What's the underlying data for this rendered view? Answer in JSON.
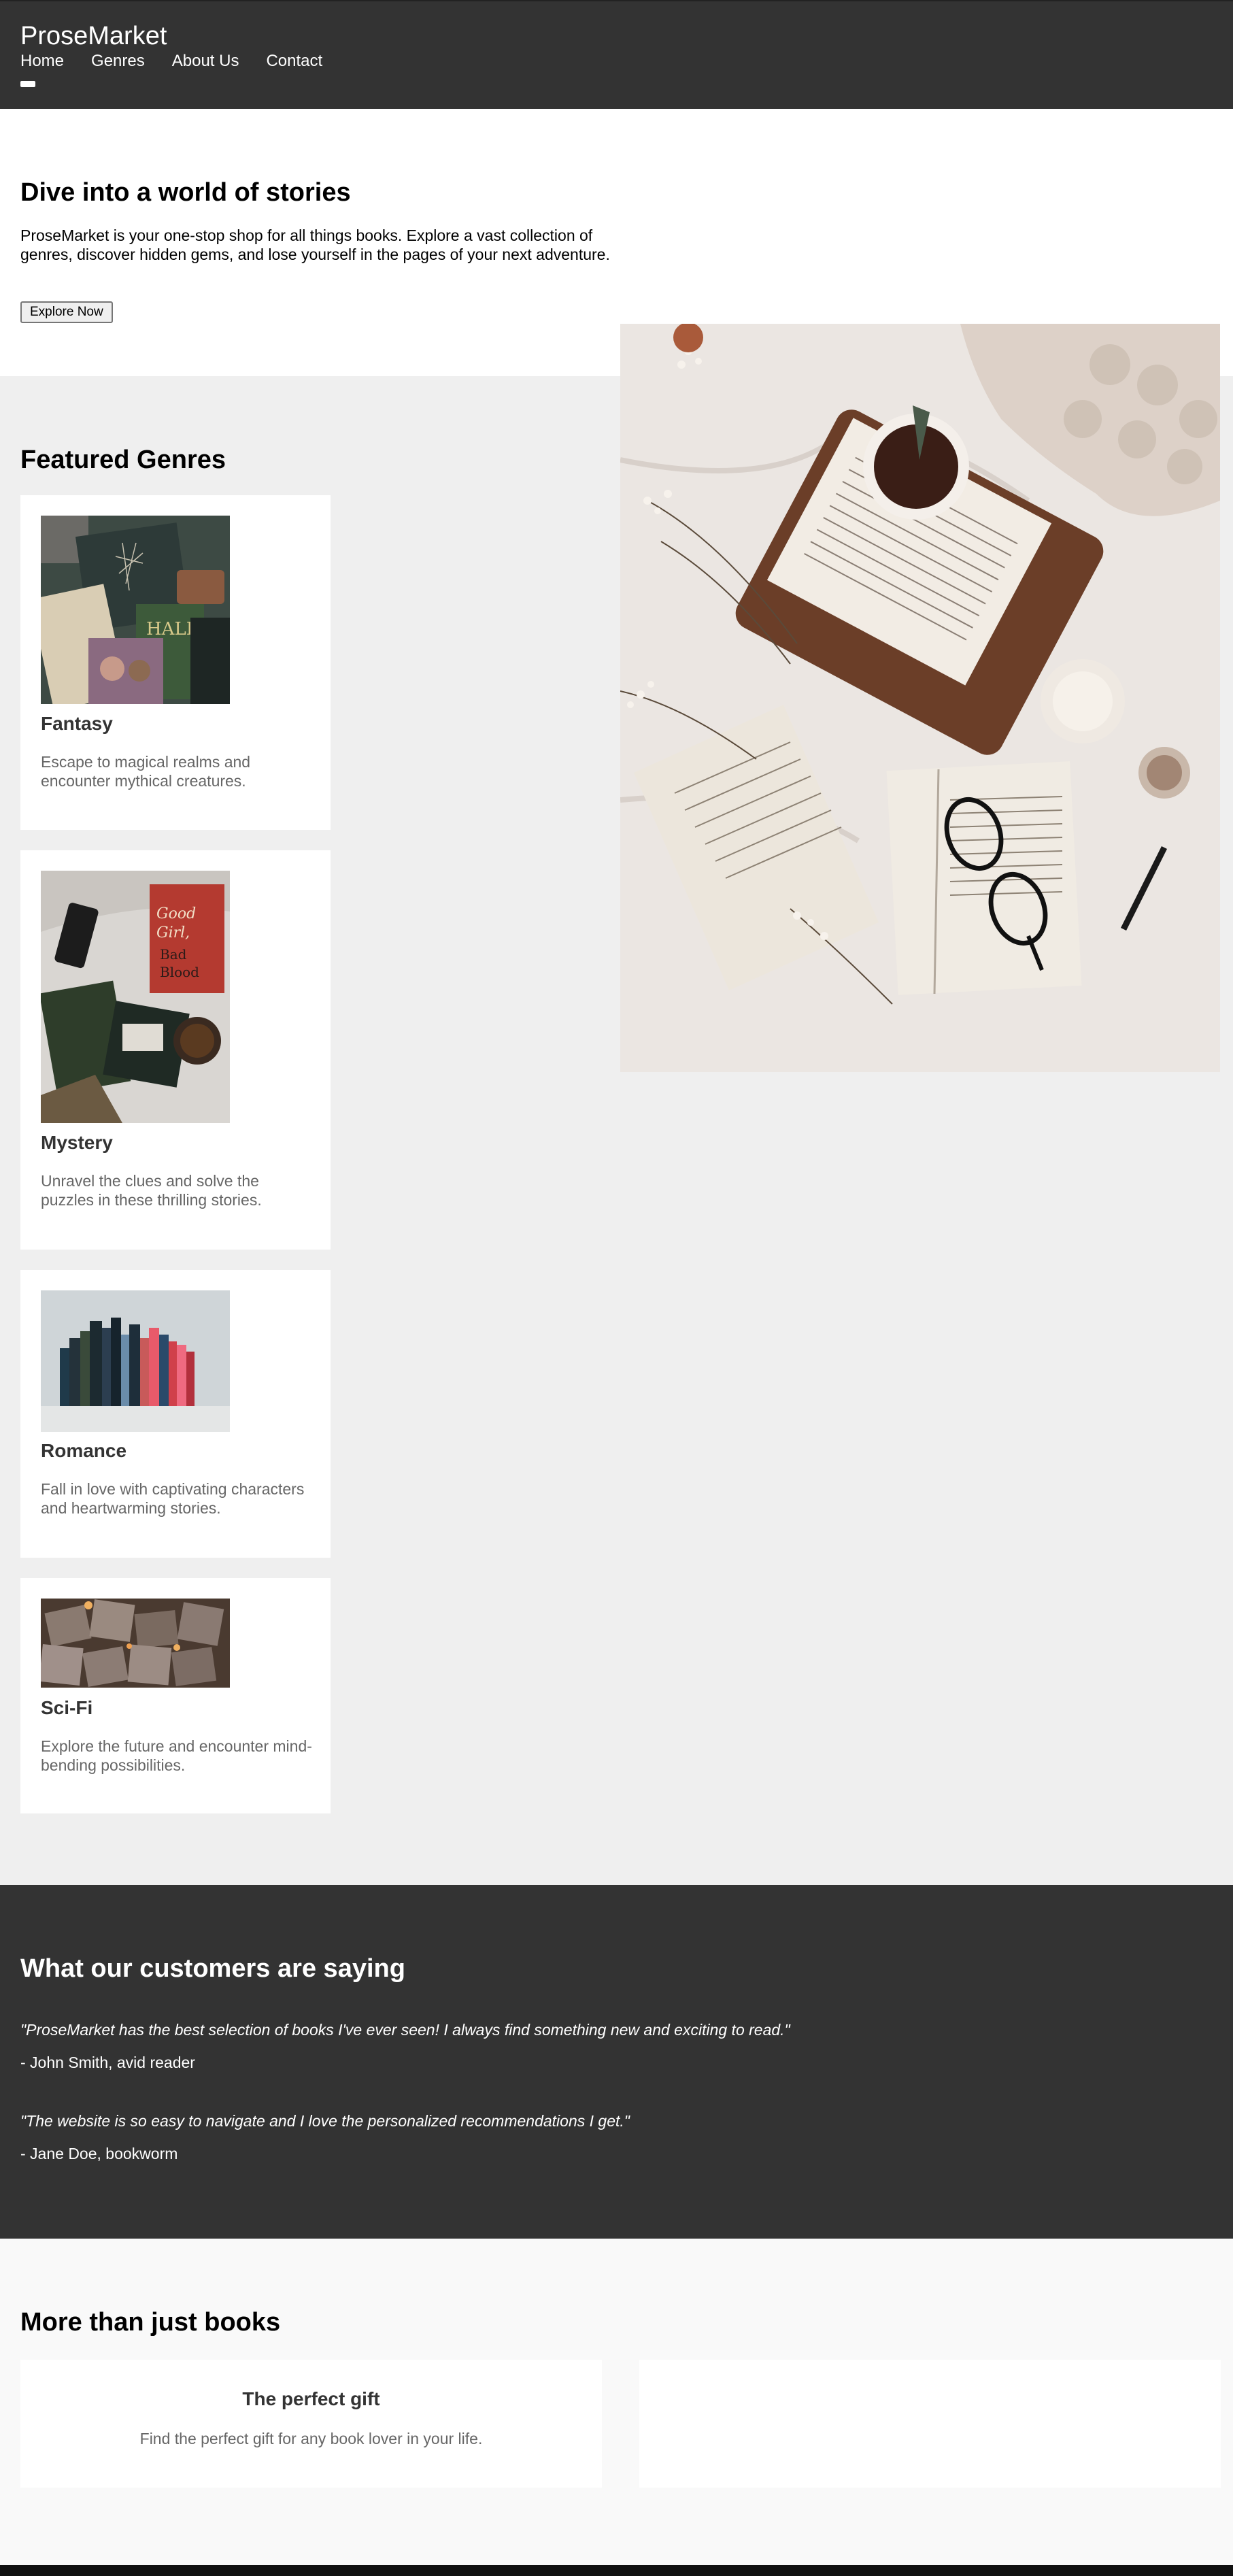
{
  "header": {
    "logo": "ProseMarket",
    "nav": [
      "Home",
      "Genres",
      "About Us",
      "Contact"
    ]
  },
  "hero": {
    "title": "Dive into a world of stories",
    "text": "ProseMarket is your one-stop shop for all things books. Explore a vast collection of genres, discover hidden gems, and lose yourself in the pages of your next adventure.",
    "button": "Explore Now"
  },
  "genres": {
    "title": "Featured Genres",
    "items": [
      {
        "name": "Fantasy",
        "desc": "Escape to magical realms and encounter mythical creatures."
      },
      {
        "name": "Mystery",
        "desc": "Unravel the clues and solve the puzzles in these thrilling stories."
      },
      {
        "name": "Romance",
        "desc": "Fall in love with captivating characters and heartwarming stories."
      },
      {
        "name": "Sci-Fi",
        "desc": "Explore the future and encounter mind-bending possibilities."
      }
    ]
  },
  "testimonials": {
    "title": "What our customers are saying",
    "items": [
      {
        "quote": "\"ProseMarket has the best selection of books I've ever seen! I always find something new and exciting to read.\"",
        "author": "- John Smith, avid reader"
      },
      {
        "quote": "\"The website is so easy to navigate and I love the personalized recommendations I get.\"",
        "author": "- Jane Doe, bookworm"
      }
    ]
  },
  "more": {
    "title": "More than just books",
    "cards": [
      {
        "title": "The perfect gift",
        "text": "Find the perfect gift for any book lover in your life."
      }
    ]
  },
  "colors": {
    "header_bg": "#333333",
    "genres_bg": "#efefef",
    "more_bg": "#f9f9f9",
    "card_bg": "#ffffff",
    "muted_text": "#666666"
  }
}
